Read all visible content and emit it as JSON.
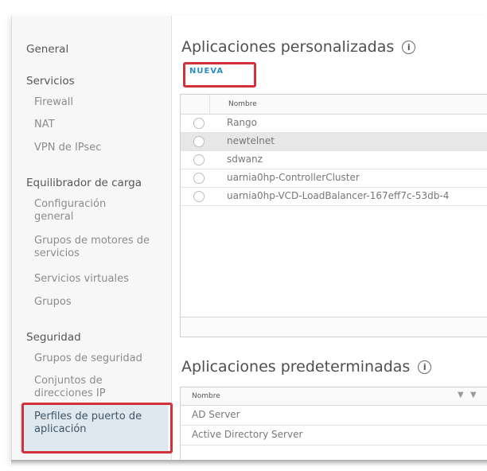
{
  "sidebar": {
    "general": "General",
    "services": {
      "header": "Servicios",
      "items": [
        "Firewall",
        "NAT",
        "VPN de IPsec"
      ]
    },
    "load_balancer": {
      "header": "Equilibrador de carga",
      "items": [
        "Configuración general",
        "Grupos de motores de servicios",
        "Servicios virtuales",
        "Grupos"
      ]
    },
    "security": {
      "header": "Seguridad",
      "items": [
        "Grupos de seguridad",
        "Conjuntos de direcciones IP",
        "Perfiles de puerto de aplicación"
      ]
    }
  },
  "custom_apps": {
    "title": "Aplicaciones personalizadas",
    "info_glyph": "i",
    "new_button": "NUEVA",
    "column_header": "Nombre",
    "rows": [
      {
        "name": "Rango",
        "selected": false
      },
      {
        "name": "newtelnet",
        "selected": true
      },
      {
        "name": "sdwanz",
        "selected": false
      },
      {
        "name": "uarnia0hp-ControllerCluster",
        "selected": false
      },
      {
        "name": "uarnia0hp-VCD-LoadBalancer-167eff7c-53db-4",
        "selected": false
      }
    ]
  },
  "default_apps": {
    "title": "Aplicaciones predeterminadas",
    "info_glyph": "i",
    "column_header": "Nombre",
    "rows": [
      "AD Server",
      "Active Directory Server"
    ]
  },
  "colors": {
    "accent": "#2c8bc0",
    "highlight_border": "#d2313b",
    "active_item_bg": "#dfe8ef"
  }
}
